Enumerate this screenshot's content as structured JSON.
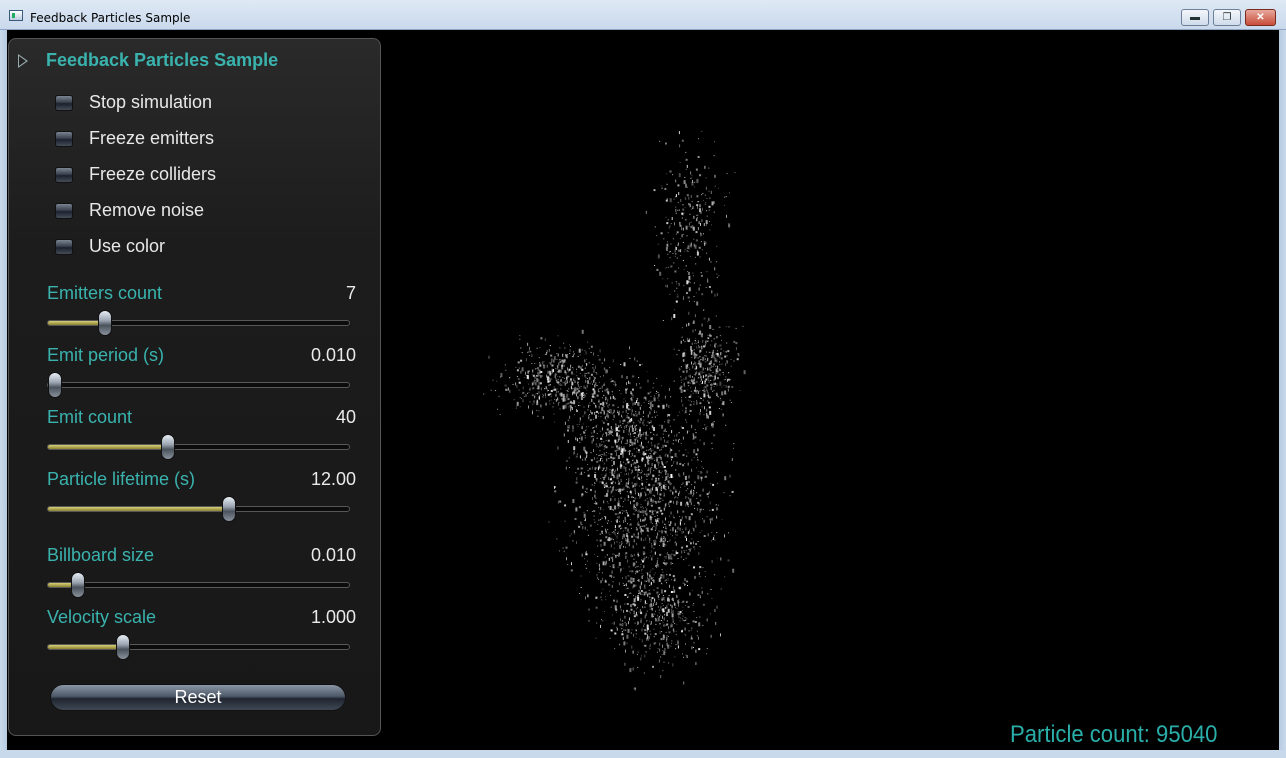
{
  "window": {
    "title": "Feedback Particles Sample",
    "minimize_label": "▬",
    "maximize_label": "❐",
    "close_label": "✕"
  },
  "panel": {
    "title": "Feedback Particles Sample",
    "checkboxes": [
      {
        "label": "Stop simulation",
        "checked": false
      },
      {
        "label": "Freeze emitters",
        "checked": false
      },
      {
        "label": "Freeze colliders",
        "checked": false
      },
      {
        "label": "Remove noise",
        "checked": false
      },
      {
        "label": "Use color",
        "checked": false
      }
    ],
    "sliders": [
      {
        "label": "Emitters count",
        "value": "7",
        "fraction": 0.19
      },
      {
        "label": "Emit period (s)",
        "value": "0.010",
        "fraction": 0.0
      },
      {
        "label": "Emit count",
        "value": "40",
        "fraction": 0.4
      },
      {
        "label": "Particle lifetime (s)",
        "value": "12.00",
        "fraction": 0.6
      },
      {
        "label": "Billboard size",
        "value": "0.010",
        "fraction": 0.1
      },
      {
        "label": "Velocity scale",
        "value": "1.000",
        "fraction": 0.25
      }
    ],
    "reset_label": "Reset"
  },
  "status": {
    "particle_count": "Particle count: 95040"
  },
  "colors": {
    "accent": "#3ab3ae",
    "slider_fill": "#c2b95e",
    "background": "#000000"
  }
}
